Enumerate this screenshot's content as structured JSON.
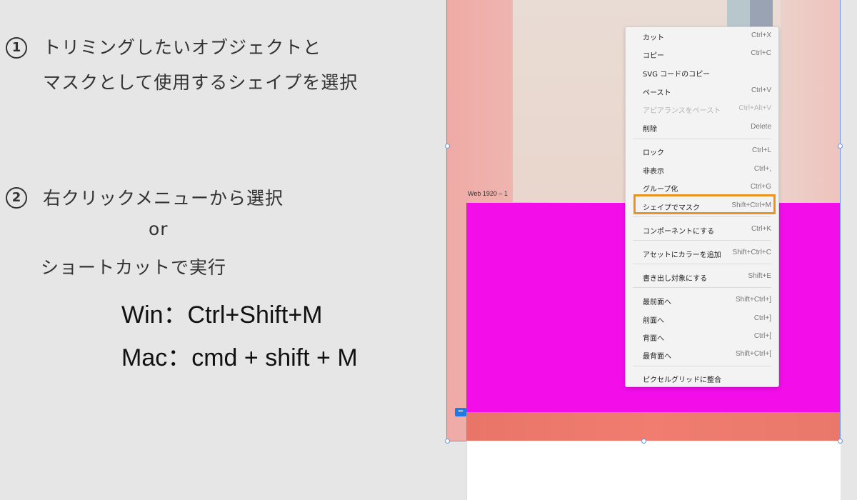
{
  "steps": [
    {
      "number": "1",
      "lines": [
        "トリミングしたいオブジェクトと",
        "マスクとして使用するシェイプを選択"
      ]
    },
    {
      "number": "2",
      "lines": [
        "右クリックメニューから選択",
        "or",
        "ショートカットで実行"
      ],
      "shortcuts": [
        "Win：Ctrl+Shift+M",
        "Mac：cmd + shift + M"
      ]
    }
  ],
  "canvas": {
    "artboard_label": "Web 1920 – 1",
    "badge": "＝",
    "colors": {
      "magenta": "#f20de9",
      "coral": "#f07d6f",
      "selection": "#6d95e8",
      "highlight": "#ec9421"
    }
  },
  "context_menu": {
    "items": [
      {
        "label": "カット",
        "shortcut": "Ctrl+X",
        "disabled": false
      },
      {
        "label": "コピー",
        "shortcut": "Ctrl+C",
        "disabled": false
      },
      {
        "label": "SVG コードのコピー",
        "shortcut": "",
        "disabled": false
      },
      {
        "label": "ペースト",
        "shortcut": "Ctrl+V",
        "disabled": false
      },
      {
        "label": "アピアランスをペースト",
        "shortcut": "Ctrl+Alt+V",
        "disabled": true
      },
      {
        "label": "削除",
        "shortcut": "Delete",
        "disabled": false
      },
      {
        "label": "ロック",
        "shortcut": "Ctrl+L",
        "disabled": false
      },
      {
        "label": "非表示",
        "shortcut": "Ctrl+,",
        "disabled": false
      },
      {
        "label": "グループ化",
        "shortcut": "Ctrl+G",
        "disabled": false
      },
      {
        "label": "シェイプでマスク",
        "shortcut": "Shift+Ctrl+M",
        "disabled": false,
        "highlighted": true
      },
      {
        "label": "コンポーネントにする",
        "shortcut": "Ctrl+K",
        "disabled": false
      },
      {
        "label": "アセットにカラーを追加",
        "shortcut": "Shift+Ctrl+C",
        "disabled": false
      },
      {
        "label": "書き出し対象にする",
        "shortcut": "Shift+E",
        "disabled": false
      },
      {
        "label": "最前面へ",
        "shortcut": "Shift+Ctrl+]",
        "disabled": false
      },
      {
        "label": "前面へ",
        "shortcut": "Ctrl+]",
        "disabled": false
      },
      {
        "label": "背面へ",
        "shortcut": "Ctrl+[",
        "disabled": false
      },
      {
        "label": "最背面へ",
        "shortcut": "Shift+Ctrl+[",
        "disabled": false
      },
      {
        "label": "ピクセルグリッドに整合",
        "shortcut": "",
        "disabled": false
      }
    ]
  }
}
